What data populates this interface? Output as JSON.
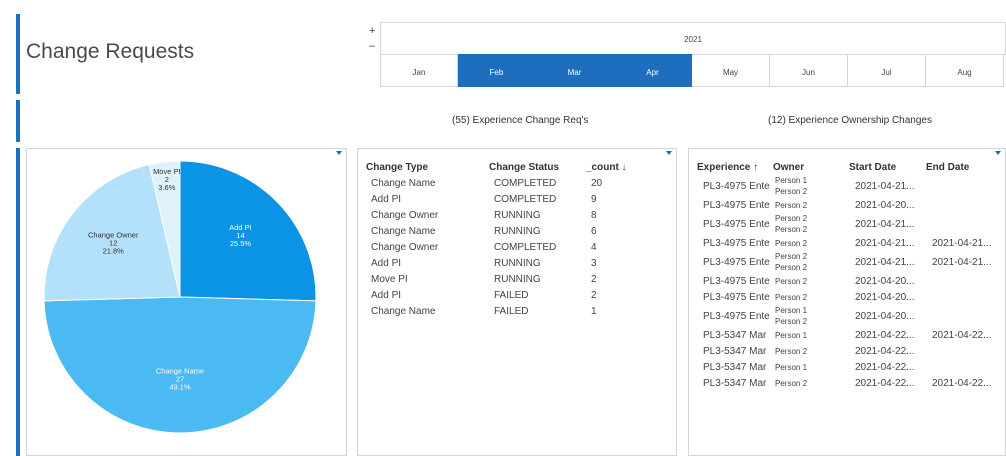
{
  "title": "Change Requests",
  "timeline": {
    "zoom_in": "+",
    "zoom_out": "–",
    "year": "2021",
    "months": [
      {
        "label": "Jan",
        "selected": false
      },
      {
        "label": "Feb",
        "selected": true
      },
      {
        "label": "Mar",
        "selected": true
      },
      {
        "label": "Apr",
        "selected": true
      },
      {
        "label": "May",
        "selected": false
      },
      {
        "label": "Jun",
        "selected": false
      },
      {
        "label": "Jul",
        "selected": false
      },
      {
        "label": "Aug",
        "selected": false
      }
    ]
  },
  "sections": {
    "change_reqs": "(55) Experience Change Req's",
    "ownership_changes": "(12) Experience Ownership Changes"
  },
  "chart_data": {
    "type": "pie",
    "slices": [
      {
        "label": "Add PI",
        "value": 14,
        "percent": "25.5%",
        "color": "#0b93e6"
      },
      {
        "label": "Change Name",
        "value": 27,
        "percent": "49.1%",
        "color": "#4bb9f2"
      },
      {
        "label": "Change Owner",
        "value": 12,
        "percent": "21.8%",
        "color": "#b3e0fa"
      },
      {
        "label": "Move PI",
        "value": 2,
        "percent": "3.6%",
        "color": "#dff2fc"
      }
    ]
  },
  "change_table": {
    "headers": [
      "Change Type",
      "Change Status",
      "_count ↓"
    ],
    "rows": [
      [
        "Change Name",
        "COMPLETED",
        "20"
      ],
      [
        "Add PI",
        "COMPLETED",
        "9"
      ],
      [
        "Change Owner",
        "RUNNING",
        "8"
      ],
      [
        "Change Name",
        "RUNNING",
        "6"
      ],
      [
        "Change Owner",
        "COMPLETED",
        "4"
      ],
      [
        "Add PI",
        "RUNNING",
        "3"
      ],
      [
        "Move PI",
        "RUNNING",
        "2"
      ],
      [
        "Add PI",
        "FAILED",
        "2"
      ],
      [
        "Change Name",
        "FAILED",
        "1"
      ]
    ]
  },
  "ownership_table": {
    "headers": [
      "Experience ↑",
      "Owner",
      "Start Date",
      "End Date"
    ],
    "rows": [
      {
        "experience": "PL3-4975 Ente",
        "owner": [
          "Person 1",
          "Person 2"
        ],
        "start": "2021-04-21...",
        "end": ""
      },
      {
        "experience": "PL3-4975 Ente",
        "owner": [
          "Person 2"
        ],
        "start": "2021-04-20...",
        "end": ""
      },
      {
        "experience": "PL3-4975 Ente",
        "owner": [
          "Person 2",
          "Person 2"
        ],
        "start": "2021-04-21...",
        "end": ""
      },
      {
        "experience": "PL3-4975 Ente",
        "owner": [
          "Person 2"
        ],
        "start": "2021-04-21...",
        "end": "2021-04-21..."
      },
      {
        "experience": "PL3-4975 Ente",
        "owner": [
          "Person 2",
          "Person 2"
        ],
        "start": "2021-04-21...",
        "end": "2021-04-21..."
      },
      {
        "experience": "PL3-4975 Ente",
        "owner": [
          "Person 2"
        ],
        "start": "2021-04-20...",
        "end": ""
      },
      {
        "experience": "PL3-4975 Ente",
        "owner": [
          "Person 2"
        ],
        "start": "2021-04-20...",
        "end": ""
      },
      {
        "experience": "PL3-4975 Ente",
        "owner": [
          "Person 1",
          "Person 2"
        ],
        "start": "2021-04-20...",
        "end": ""
      },
      {
        "experience": "PL3-5347 Mar",
        "owner": [
          "Person 1"
        ],
        "start": "2021-04-22...",
        "end": "2021-04-22..."
      },
      {
        "experience": "PL3-5347 Mar",
        "owner": [
          "Person 2"
        ],
        "start": "2021-04-22...",
        "end": ""
      },
      {
        "experience": "PL3-5347 Mar",
        "owner": [
          "Person 1"
        ],
        "start": "2021-04-22...",
        "end": ""
      },
      {
        "experience": "PL3-5347 Mar",
        "owner": [
          "Person 2"
        ],
        "start": "2021-04-22...",
        "end": "2021-04-22..."
      }
    ]
  }
}
